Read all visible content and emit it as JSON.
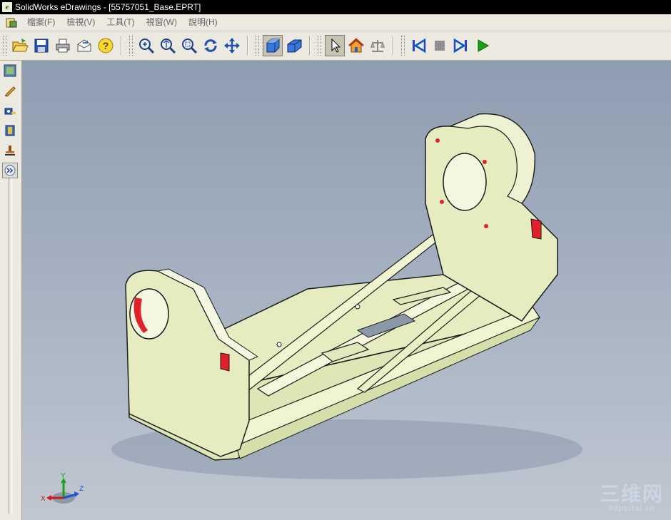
{
  "window": {
    "title": "SolidWorks eDrawings - [55757051_Base.EPRT]",
    "icon_glyph": "e"
  },
  "menubar": {
    "items": [
      {
        "label": "檔案(F)"
      },
      {
        "label": "檢視(V)"
      },
      {
        "label": "工具(T)"
      },
      {
        "label": "視窗(W)"
      },
      {
        "label": "說明(H)"
      }
    ]
  },
  "toolbar": {
    "groups": [
      [
        "open-icon",
        "save-icon",
        "print-icon",
        "send-mail-icon",
        "help-icon"
      ],
      [
        "zoom-to-fit-icon",
        "zoom-in-out-icon",
        "zoom-to-area-icon",
        "rotate-icon",
        "pan-icon"
      ],
      [
        "shaded-view-icon",
        "perspective-icon"
      ],
      [
        "select-icon",
        "home-icon",
        "measure-icon"
      ],
      [
        "first-frame-icon",
        "stop-icon",
        "next-frame-icon",
        "play-icon"
      ]
    ]
  },
  "sidebar": {
    "tools": [
      "component-tree-icon",
      "markup-icon",
      "measure-tape-icon",
      "section-icon",
      "stamp-icon",
      "expand-icon"
    ]
  },
  "triad": {
    "x_label": "X",
    "y_label": "Y",
    "z_label": "Z"
  },
  "watermark": {
    "main": "三维网",
    "sub": "3dportal.cn"
  },
  "colors": {
    "part_body": "#e6ecc0",
    "part_edge": "#1a1a1a",
    "hole_highlight": "#e0202a",
    "viewport_top": "#8e9db0",
    "viewport_bottom": "#c0c7d2"
  }
}
